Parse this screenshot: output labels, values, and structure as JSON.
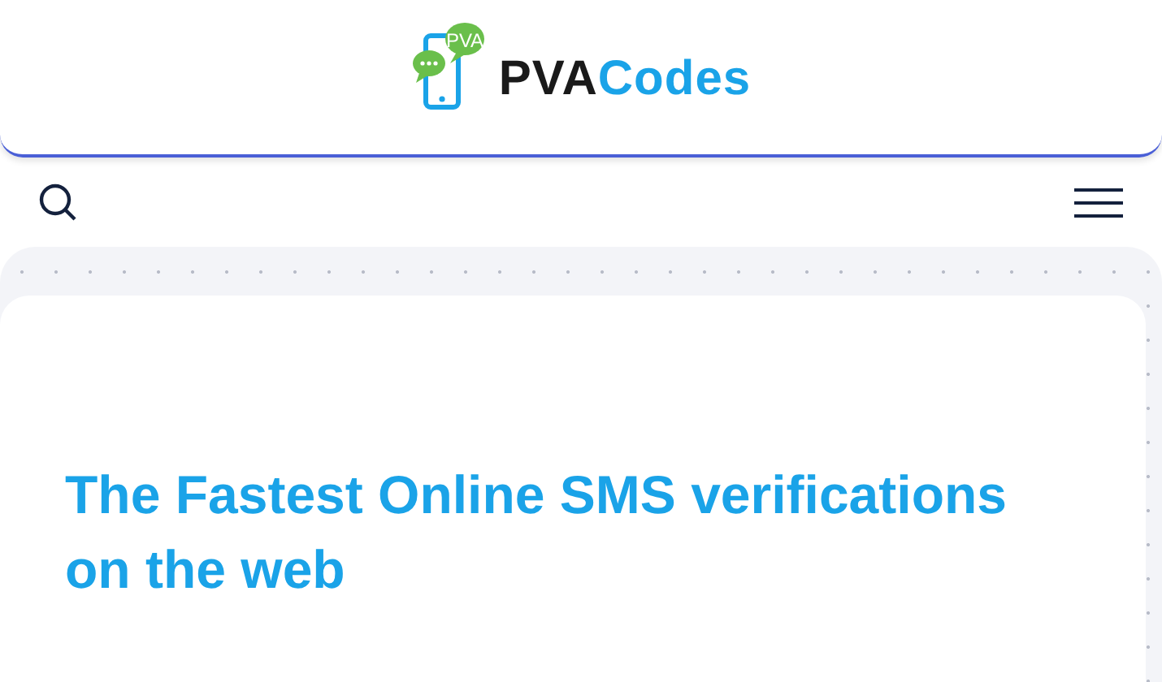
{
  "logo": {
    "bubble_text": "PVA",
    "brand_dark": "PVA",
    "brand_light": "Codes"
  },
  "hero": {
    "heading": "The Fastest Online SMS verifications on the web"
  }
}
